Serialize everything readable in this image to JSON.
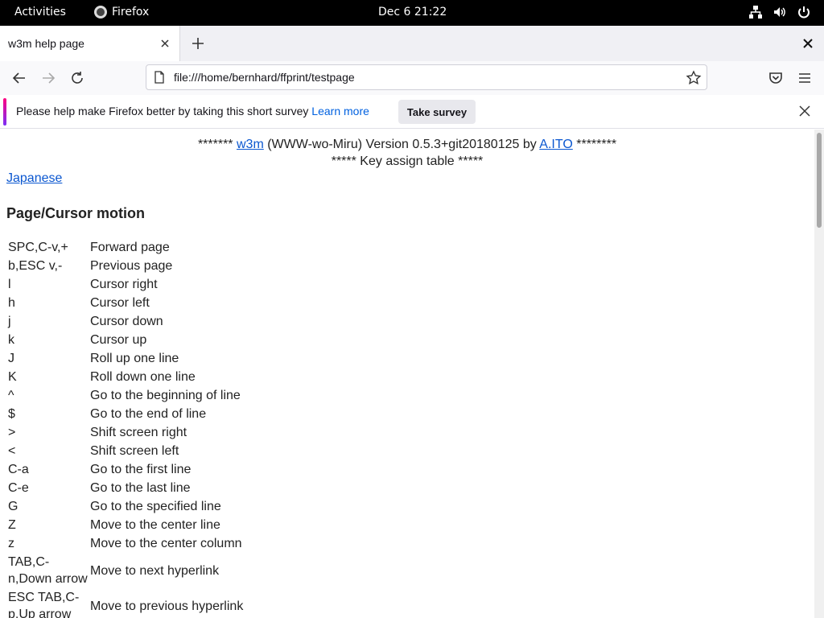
{
  "system_bar": {
    "activities": "Activities",
    "app_name": "Firefox",
    "clock": "Dec 6  21:22"
  },
  "browser": {
    "tab_title": "w3m help page",
    "url": "file:///home/bernhard/ffprint/testpage"
  },
  "notification": {
    "message": "Please help make Firefox better by taking this short survey",
    "learn_more": "Learn more",
    "button": "Take survey"
  },
  "page": {
    "stars_left": "*******",
    "w3m_link": "w3m",
    "version_text": "(WWW-wo-Miru) Version 0.5.3+git20180125 by",
    "author_link": "A.ITO",
    "stars_right": "********",
    "subtitle": "***** Key assign table *****",
    "language_link": "Japanese",
    "section_title": "Page/Cursor motion",
    "bindings": [
      {
        "key": "SPC,C-v,+",
        "action": "Forward page"
      },
      {
        "key": "b,ESC v,-",
        "action": "Previous page"
      },
      {
        "key": "l",
        "action": "Cursor right"
      },
      {
        "key": "h",
        "action": "Cursor left"
      },
      {
        "key": "j",
        "action": "Cursor down"
      },
      {
        "key": "k",
        "action": "Cursor up"
      },
      {
        "key": "J",
        "action": "Roll up one line"
      },
      {
        "key": "K",
        "action": "Roll down one line"
      },
      {
        "key": "^",
        "action": "Go to the beginning of line"
      },
      {
        "key": "$",
        "action": "Go to the end of line"
      },
      {
        "key": ">",
        "action": "Shift screen right"
      },
      {
        "key": "<",
        "action": "Shift screen left"
      },
      {
        "key": "C-a",
        "action": "Go to the first line"
      },
      {
        "key": "C-e",
        "action": "Go to the last line"
      },
      {
        "key": "G",
        "action": "Go to the specified line"
      },
      {
        "key": "Z",
        "action": "Move to the center line"
      },
      {
        "key": "z",
        "action": "Move to the center column"
      },
      {
        "key": "TAB,C-n,Down arrow",
        "action": "Move to next hyperlink"
      },
      {
        "key": "ESC TAB,C-p,Up arrow",
        "action": "Move to previous hyperlink"
      }
    ]
  },
  "colors": {
    "link": "#0b57d0",
    "topbar_bg": "#000000",
    "notification_accent": "#ff0080"
  }
}
